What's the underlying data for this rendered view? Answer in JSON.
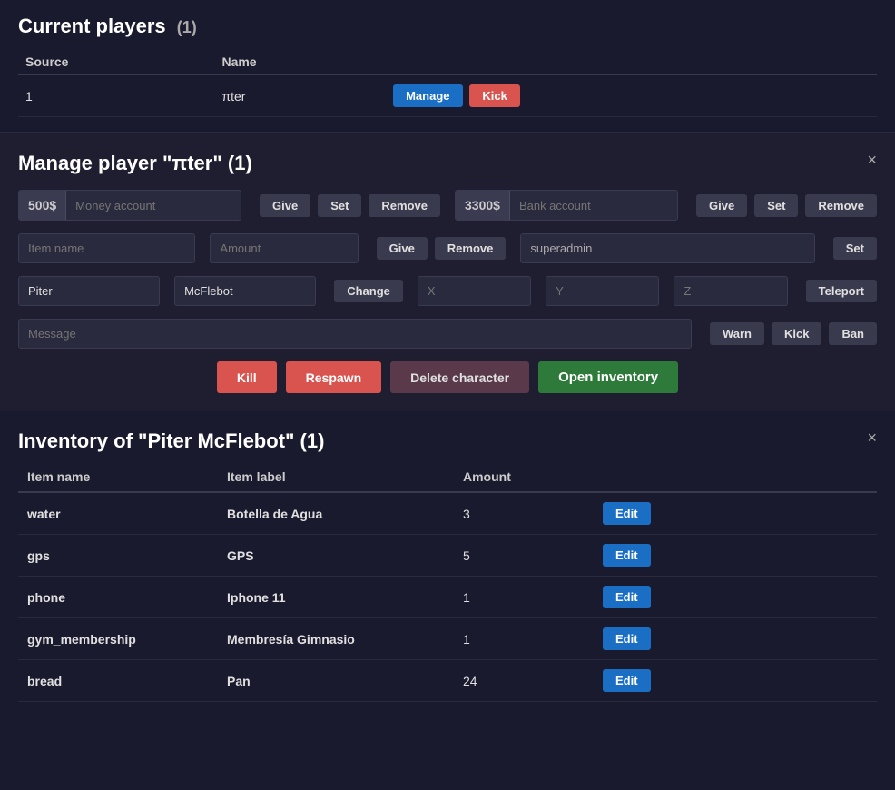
{
  "currentPlayers": {
    "title": "Current players",
    "count": "(1)",
    "columns": [
      "Source",
      "Name"
    ],
    "rows": [
      {
        "source": "1",
        "name": "πter",
        "manage_label": "Manage",
        "kick_label": "Kick"
      }
    ]
  },
  "managePlayer": {
    "title": "Manage player \"πter\" (1)",
    "close": "×",
    "moneyAccount": {
      "prefix": "500$",
      "placeholder": "Money account"
    },
    "bankAccount": {
      "prefix": "3300$",
      "placeholder": "Bank account"
    },
    "give_label": "Give",
    "set_label": "Set",
    "remove_label": "Remove",
    "itemNamePlaceholder": "Item name",
    "amountPlaceholder": "Amount",
    "superadminValue": "superadmin",
    "firstName": "Piter",
    "lastName": "McFlebot",
    "change_label": "Change",
    "xPlaceholder": "X",
    "yPlaceholder": "Y",
    "zPlaceholder": "Z",
    "teleport_label": "Teleport",
    "messagePlaceholder": "Message",
    "warn_label": "Warn",
    "kick_label": "Kick",
    "ban_label": "Ban",
    "kill_label": "Kill",
    "respawn_label": "Respawn",
    "delete_label": "Delete character",
    "openInventory_label": "Open inventory"
  },
  "inventory": {
    "title": "Inventory of \"Piter McFlebot\" (1)",
    "close": "×",
    "columns": [
      "Item name",
      "Item label",
      "Amount"
    ],
    "edit_label": "Edit",
    "items": [
      {
        "name": "water",
        "label": "Botella de Agua",
        "amount": "3"
      },
      {
        "name": "gps",
        "label": "GPS",
        "amount": "5"
      },
      {
        "name": "phone",
        "label": "Iphone 11",
        "amount": "1"
      },
      {
        "name": "gym_membership",
        "label": "Membresía Gimnasio",
        "amount": "1"
      },
      {
        "name": "bread",
        "label": "Pan",
        "amount": "24"
      }
    ]
  }
}
